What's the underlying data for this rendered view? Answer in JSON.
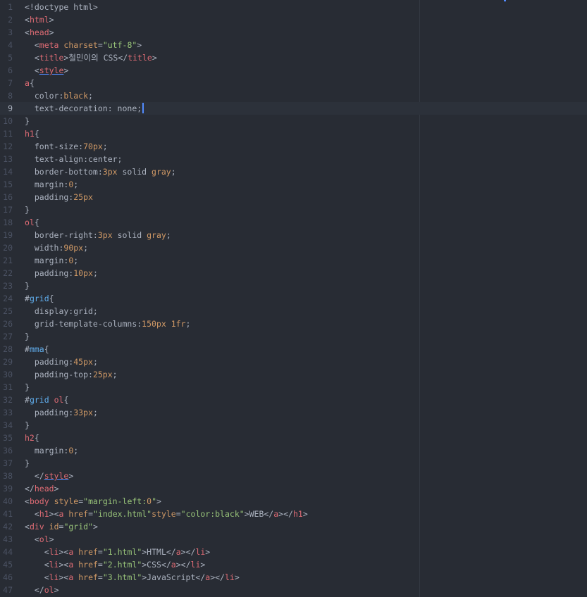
{
  "editor": {
    "current_line": 9,
    "lines": [
      {
        "n": "1",
        "tokens": [
          [
            "plain",
            "<!doctype html>"
          ]
        ]
      },
      {
        "n": "2",
        "tokens": [
          [
            "plain",
            "<"
          ],
          [
            "tag",
            "html"
          ],
          [
            "plain",
            ">"
          ]
        ]
      },
      {
        "n": "3",
        "tokens": [
          [
            "plain",
            "<"
          ],
          [
            "tag",
            "head"
          ],
          [
            "plain",
            ">"
          ]
        ]
      },
      {
        "n": "4",
        "tokens": [
          [
            "plain",
            "  <"
          ],
          [
            "tag",
            "meta"
          ],
          [
            "plain",
            " "
          ],
          [
            "attr",
            "charset"
          ],
          [
            "plain",
            "="
          ],
          [
            "str",
            "\"utf-8\""
          ],
          [
            "plain",
            ">"
          ]
        ]
      },
      {
        "n": "5",
        "tokens": [
          [
            "plain",
            "  <"
          ],
          [
            "tag",
            "title"
          ],
          [
            "plain",
            ">철민이의 CSS</"
          ],
          [
            "tag",
            "title"
          ],
          [
            "plain",
            ">"
          ]
        ]
      },
      {
        "n": "6",
        "tokens": [
          [
            "plain",
            "  <"
          ],
          [
            "tagu",
            "style"
          ],
          [
            "plain",
            ">"
          ]
        ]
      },
      {
        "n": "7",
        "tokens": [
          [
            "sel",
            "a"
          ],
          [
            "plain",
            "{"
          ]
        ]
      },
      {
        "n": "8",
        "tokens": [
          [
            "plain",
            "  color:"
          ],
          [
            "val",
            "black"
          ],
          [
            "plain",
            ";"
          ]
        ]
      },
      {
        "n": "9",
        "tokens": [
          [
            "plain",
            "  text-decoration: none;"
          ]
        ],
        "cursor": true
      },
      {
        "n": "10",
        "tokens": [
          [
            "plain",
            "}"
          ]
        ]
      },
      {
        "n": "11",
        "tokens": [
          [
            "sel",
            "h1"
          ],
          [
            "plain",
            "{"
          ]
        ]
      },
      {
        "n": "12",
        "tokens": [
          [
            "plain",
            "  font-size:"
          ],
          [
            "num",
            "70px"
          ],
          [
            "plain",
            ";"
          ]
        ]
      },
      {
        "n": "13",
        "tokens": [
          [
            "plain",
            "  text-align:center;"
          ]
        ]
      },
      {
        "n": "14",
        "tokens": [
          [
            "plain",
            "  border-bottom:"
          ],
          [
            "num",
            "3px"
          ],
          [
            "plain",
            " solid "
          ],
          [
            "val",
            "gray"
          ],
          [
            "plain",
            ";"
          ]
        ]
      },
      {
        "n": "15",
        "tokens": [
          [
            "plain",
            "  margin:"
          ],
          [
            "num",
            "0"
          ],
          [
            "plain",
            ";"
          ]
        ]
      },
      {
        "n": "16",
        "tokens": [
          [
            "plain",
            "  padding:"
          ],
          [
            "num",
            "25px"
          ]
        ]
      },
      {
        "n": "17",
        "tokens": [
          [
            "plain",
            "}"
          ]
        ]
      },
      {
        "n": "18",
        "tokens": [
          [
            "sel",
            "ol"
          ],
          [
            "plain",
            "{"
          ]
        ]
      },
      {
        "n": "19",
        "tokens": [
          [
            "plain",
            "  border-right:"
          ],
          [
            "num",
            "3px"
          ],
          [
            "plain",
            " solid "
          ],
          [
            "val",
            "gray"
          ],
          [
            "plain",
            ";"
          ]
        ]
      },
      {
        "n": "20",
        "tokens": [
          [
            "plain",
            "  width:"
          ],
          [
            "num",
            "90px"
          ],
          [
            "plain",
            ";"
          ]
        ]
      },
      {
        "n": "21",
        "tokens": [
          [
            "plain",
            "  margin:"
          ],
          [
            "num",
            "0"
          ],
          [
            "plain",
            ";"
          ]
        ]
      },
      {
        "n": "22",
        "tokens": [
          [
            "plain",
            "  padding:"
          ],
          [
            "num",
            "10px"
          ],
          [
            "plain",
            ";"
          ]
        ]
      },
      {
        "n": "23",
        "tokens": [
          [
            "plain",
            "}"
          ]
        ]
      },
      {
        "n": "24",
        "tokens": [
          [
            "hash",
            "#"
          ],
          [
            "id",
            "grid"
          ],
          [
            "plain",
            "{"
          ]
        ]
      },
      {
        "n": "25",
        "tokens": [
          [
            "plain",
            "  display:grid;"
          ]
        ]
      },
      {
        "n": "26",
        "tokens": [
          [
            "plain",
            "  grid-template-columns:"
          ],
          [
            "num",
            "150px"
          ],
          [
            "plain",
            " "
          ],
          [
            "num",
            "1fr"
          ],
          [
            "plain",
            ";"
          ]
        ]
      },
      {
        "n": "27",
        "tokens": [
          [
            "plain",
            "}"
          ]
        ]
      },
      {
        "n": "28",
        "tokens": [
          [
            "hash",
            "#"
          ],
          [
            "id",
            "mma"
          ],
          [
            "plain",
            "{"
          ]
        ]
      },
      {
        "n": "29",
        "tokens": [
          [
            "plain",
            "  padding:"
          ],
          [
            "num",
            "45px"
          ],
          [
            "plain",
            ";"
          ]
        ]
      },
      {
        "n": "30",
        "tokens": [
          [
            "plain",
            "  padding-top:"
          ],
          [
            "num",
            "25px"
          ],
          [
            "plain",
            ";"
          ]
        ]
      },
      {
        "n": "31",
        "tokens": [
          [
            "plain",
            "}"
          ]
        ]
      },
      {
        "n": "32",
        "tokens": [
          [
            "hash",
            "#"
          ],
          [
            "id",
            "grid"
          ],
          [
            "plain",
            " "
          ],
          [
            "sel",
            "ol"
          ],
          [
            "plain",
            "{"
          ]
        ]
      },
      {
        "n": "33",
        "tokens": [
          [
            "plain",
            "  padding:"
          ],
          [
            "num",
            "33px"
          ],
          [
            "plain",
            ";"
          ]
        ]
      },
      {
        "n": "34",
        "tokens": [
          [
            "plain",
            "}"
          ]
        ]
      },
      {
        "n": "35",
        "tokens": [
          [
            "sel",
            "h2"
          ],
          [
            "plain",
            "{"
          ]
        ]
      },
      {
        "n": "36",
        "tokens": [
          [
            "plain",
            "  margin:"
          ],
          [
            "num",
            "0"
          ],
          [
            "plain",
            ";"
          ]
        ]
      },
      {
        "n": "37",
        "tokens": [
          [
            "plain",
            "}"
          ]
        ]
      },
      {
        "n": "38",
        "tokens": [
          [
            "plain",
            "  </"
          ],
          [
            "tagu",
            "style"
          ],
          [
            "plain",
            ">"
          ]
        ]
      },
      {
        "n": "39",
        "tokens": [
          [
            "plain",
            "</"
          ],
          [
            "tag",
            "head"
          ],
          [
            "plain",
            ">"
          ]
        ]
      },
      {
        "n": "40",
        "tokens": [
          [
            "plain",
            "<"
          ],
          [
            "tag",
            "body"
          ],
          [
            "plain",
            " "
          ],
          [
            "attr",
            "style"
          ],
          [
            "plain",
            "="
          ],
          [
            "str",
            "\"margin-left:"
          ],
          [
            "num",
            "0"
          ],
          [
            "str",
            "\""
          ],
          [
            "plain",
            ">"
          ]
        ]
      },
      {
        "n": "41",
        "tokens": [
          [
            "plain",
            "  <"
          ],
          [
            "tag",
            "h1"
          ],
          [
            "plain",
            "><"
          ],
          [
            "tag",
            "a"
          ],
          [
            "plain",
            " "
          ],
          [
            "attr",
            "href"
          ],
          [
            "plain",
            "="
          ],
          [
            "str",
            "\"index.html\""
          ],
          [
            "attr",
            "style"
          ],
          [
            "plain",
            "="
          ],
          [
            "str",
            "\"color:black\""
          ],
          [
            "plain",
            ">WEB</"
          ],
          [
            "tag",
            "a"
          ],
          [
            "plain",
            "></"
          ],
          [
            "tag",
            "h1"
          ],
          [
            "plain",
            ">"
          ]
        ]
      },
      {
        "n": "42",
        "tokens": [
          [
            "plain",
            "<"
          ],
          [
            "tag",
            "div"
          ],
          [
            "plain",
            " "
          ],
          [
            "attr",
            "id"
          ],
          [
            "plain",
            "="
          ],
          [
            "str",
            "\"grid\""
          ],
          [
            "plain",
            ">"
          ]
        ]
      },
      {
        "n": "43",
        "tokens": [
          [
            "plain",
            "  <"
          ],
          [
            "tag",
            "ol"
          ],
          [
            "plain",
            ">"
          ]
        ]
      },
      {
        "n": "44",
        "tokens": [
          [
            "plain",
            "    <"
          ],
          [
            "tag",
            "li"
          ],
          [
            "plain",
            "><"
          ],
          [
            "tag",
            "a"
          ],
          [
            "plain",
            " "
          ],
          [
            "attr",
            "href"
          ],
          [
            "plain",
            "="
          ],
          [
            "str",
            "\"1.html\""
          ],
          [
            "plain",
            ">HTML</"
          ],
          [
            "tag",
            "a"
          ],
          [
            "plain",
            "></"
          ],
          [
            "tag",
            "li"
          ],
          [
            "plain",
            ">"
          ]
        ]
      },
      {
        "n": "45",
        "tokens": [
          [
            "plain",
            "    <"
          ],
          [
            "tag",
            "li"
          ],
          [
            "plain",
            "><"
          ],
          [
            "tag",
            "a"
          ],
          [
            "plain",
            " "
          ],
          [
            "attr",
            "href"
          ],
          [
            "plain",
            "="
          ],
          [
            "str",
            "\"2.html\""
          ],
          [
            "plain",
            ">CSS</"
          ],
          [
            "tag",
            "a"
          ],
          [
            "plain",
            "></"
          ],
          [
            "tag",
            "li"
          ],
          [
            "plain",
            ">"
          ]
        ]
      },
      {
        "n": "46",
        "tokens": [
          [
            "plain",
            "    <"
          ],
          [
            "tag",
            "li"
          ],
          [
            "plain",
            "><"
          ],
          [
            "tag",
            "a"
          ],
          [
            "plain",
            " "
          ],
          [
            "attr",
            "href"
          ],
          [
            "plain",
            "="
          ],
          [
            "str",
            "\"3.html\""
          ],
          [
            "plain",
            ">JavaScript</"
          ],
          [
            "tag",
            "a"
          ],
          [
            "plain",
            "></"
          ],
          [
            "tag",
            "li"
          ],
          [
            "plain",
            ">"
          ]
        ]
      },
      {
        "n": "47",
        "tokens": [
          [
            "plain",
            "  </"
          ],
          [
            "tag",
            "ol"
          ],
          [
            "plain",
            ">"
          ]
        ]
      }
    ]
  }
}
